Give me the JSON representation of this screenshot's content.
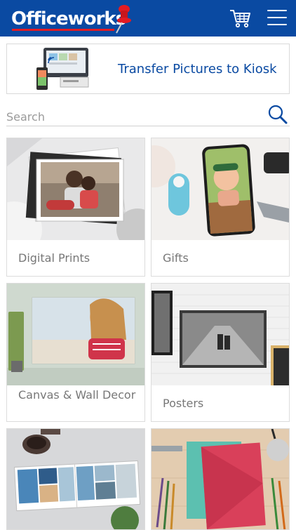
{
  "header": {
    "brand": "Officeworks",
    "cart_icon": "cart-icon",
    "menu_icon": "hamburger-menu-icon",
    "colors": {
      "background": "#0a4aa2",
      "accent": "#e31b23"
    }
  },
  "kiosk_banner": {
    "label": "Transfer Pictures to Kiosk"
  },
  "search": {
    "placeholder": "Search",
    "value": "",
    "icon": "search-icon"
  },
  "categories": [
    {
      "label": "Digital Prints"
    },
    {
      "label": "Gifts"
    },
    {
      "label": "Canvas & Wall Decor"
    },
    {
      "label": "Posters"
    },
    {
      "label": ""
    },
    {
      "label": ""
    }
  ]
}
